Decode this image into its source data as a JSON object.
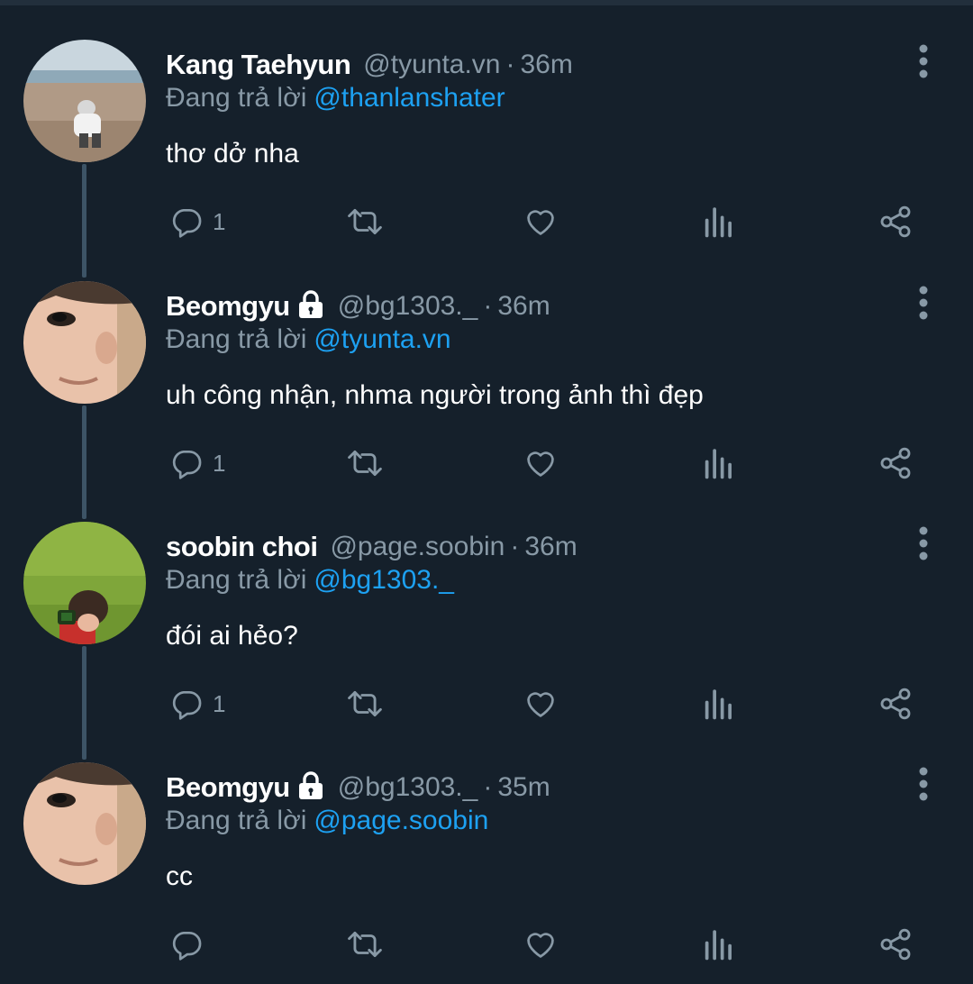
{
  "colors": {
    "background": "#15202b",
    "link": "#1da1f2",
    "muted": "#8899a6",
    "thread_line": "#3d5466"
  },
  "reply_label": "Đang trả lời",
  "tweets": [
    {
      "name": "Kang Taehyun",
      "locked": false,
      "handle": "@tyunta.vn",
      "separator": "·",
      "time": "36m",
      "reply_to": "@thanlanshater",
      "text": "thơ dở nha",
      "reply_count": "1",
      "avatar": "beach-photo"
    },
    {
      "name": "Beomgyu",
      "locked": true,
      "handle": "@bg1303._",
      "separator": "·",
      "time": "36m",
      "reply_to": "@tyunta.vn",
      "text": "uh công nhận, nhma người trong ảnh thì đẹp",
      "reply_count": "1",
      "avatar": "face-closeup"
    },
    {
      "name": "soobin choi",
      "locked": false,
      "handle": "@page.soobin",
      "separator": "·",
      "time": "36m",
      "reply_to": "@bg1303._",
      "text": "đói ai hẻo?",
      "reply_count": "1",
      "avatar": "grass-camera-photo"
    },
    {
      "name": "Beomgyu",
      "locked": true,
      "handle": "@bg1303._",
      "separator": "·",
      "time": "35m",
      "reply_to": "@page.soobin",
      "text": "cc",
      "reply_count": "",
      "avatar": "face-closeup"
    }
  ],
  "icons": {
    "reply": "reply-icon",
    "retweet": "retweet-icon",
    "like": "heart-icon",
    "analytics": "analytics-icon",
    "share": "share-icon",
    "more": "more-vertical-icon",
    "lock": "lock-icon"
  }
}
